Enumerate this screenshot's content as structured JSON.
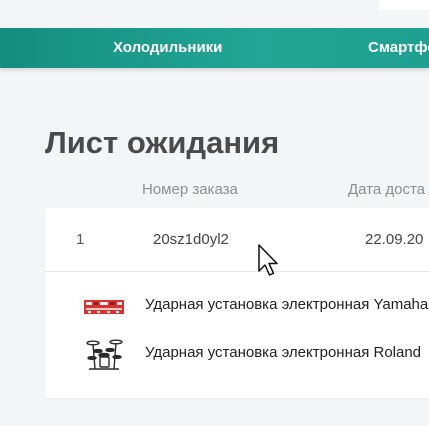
{
  "nav": {
    "items": [
      "Холодильники",
      "Смартфоны"
    ]
  },
  "page": {
    "title": "Лист ожидания"
  },
  "table": {
    "headers": {
      "order": "Номер заказа",
      "date": "Дата доста"
    },
    "order": {
      "index": "1",
      "number": "20sz1d0yl2",
      "date": "22.09.20"
    },
    "products": [
      {
        "name": "Ударная установка электронная Yamaha",
        "icon": "drum-kit-red-panel-icon"
      },
      {
        "name": "Ударная установка электронная Roland",
        "icon": "drum-kit-icon"
      }
    ]
  },
  "colors": {
    "nav_accent": "#1fa090",
    "background": "#f4f5f7"
  }
}
